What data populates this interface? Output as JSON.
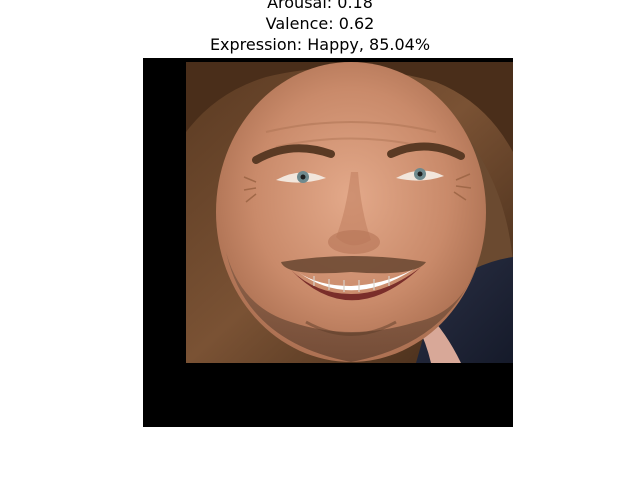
{
  "figure": {
    "arousal_text": "Arousal: 0.18",
    "valence_text": "Valence: 0.62",
    "expression_text": "Expression: Happy, 85.04%"
  },
  "image": {
    "subject": "smiling-man-face-photo",
    "background_fill": "#000000"
  }
}
